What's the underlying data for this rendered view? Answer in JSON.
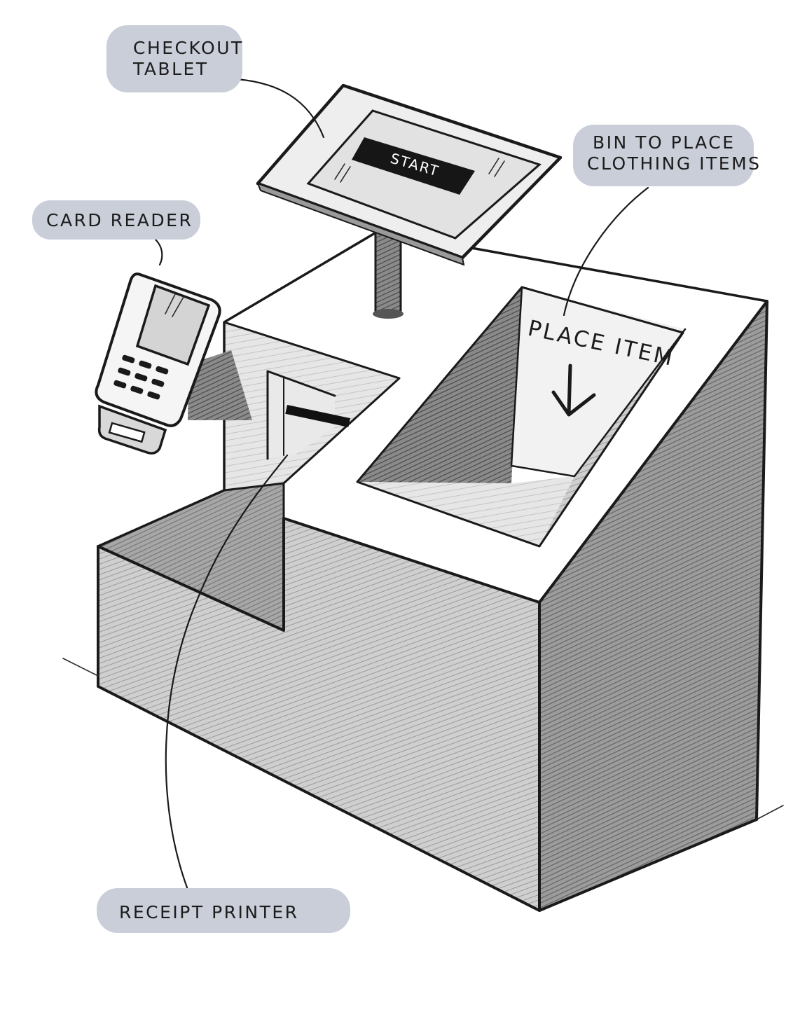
{
  "labels": {
    "checkout_tablet_line1": "CHECKOUT",
    "checkout_tablet_line2": "TABLET",
    "card_reader": "CARD READER",
    "bin_line1": "BIN TO PLACE",
    "bin_line2": "CLOTHING ITEMS",
    "receipt_printer": "RECEIPT PRINTER"
  },
  "screen": {
    "start_button": "START"
  },
  "bin_sign": {
    "text": "PLACE ITEM"
  },
  "colors": {
    "label_bubble": "#c9ced9",
    "ink": "#1a1a1a",
    "shade_light": "#d9d9d9",
    "shade_mid": "#b5b5b5",
    "shade_dark": "#6e6e6e",
    "button_fill": "#161616"
  }
}
